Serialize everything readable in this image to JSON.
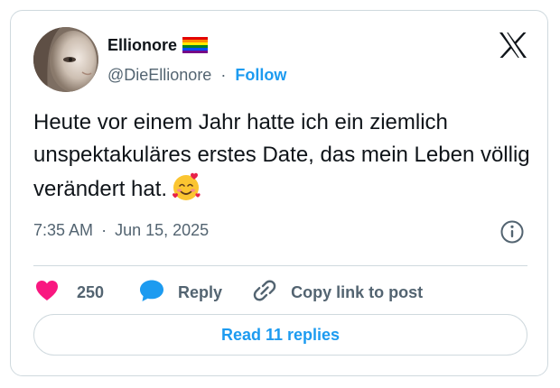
{
  "author": {
    "display_name": "Ellionore",
    "handle": "@DieEllionore",
    "separator": "·",
    "follow_label": "Follow",
    "badge_icon": "rainbow-flag-icon"
  },
  "tweet": {
    "text": "Heute vor einem Jahr hatte ich ein ziemlich unspektakuläres erstes Date, das mein Leben völlig verändert hat.",
    "emoji_icon": "smiling-face-with-hearts-icon",
    "time": "7:35 AM",
    "date_separator": "·",
    "date": "Jun 15, 2025"
  },
  "actions": {
    "like_count": "250",
    "reply_label": "Reply",
    "copy_label": "Copy link to post"
  },
  "footer": {
    "read_replies_label": "Read 11 replies"
  },
  "colors": {
    "like": "#f91880",
    "reply": "#1d9bf0",
    "link": "#1d9bf0",
    "muted_text": "#536471",
    "border": "#cfd9de"
  }
}
